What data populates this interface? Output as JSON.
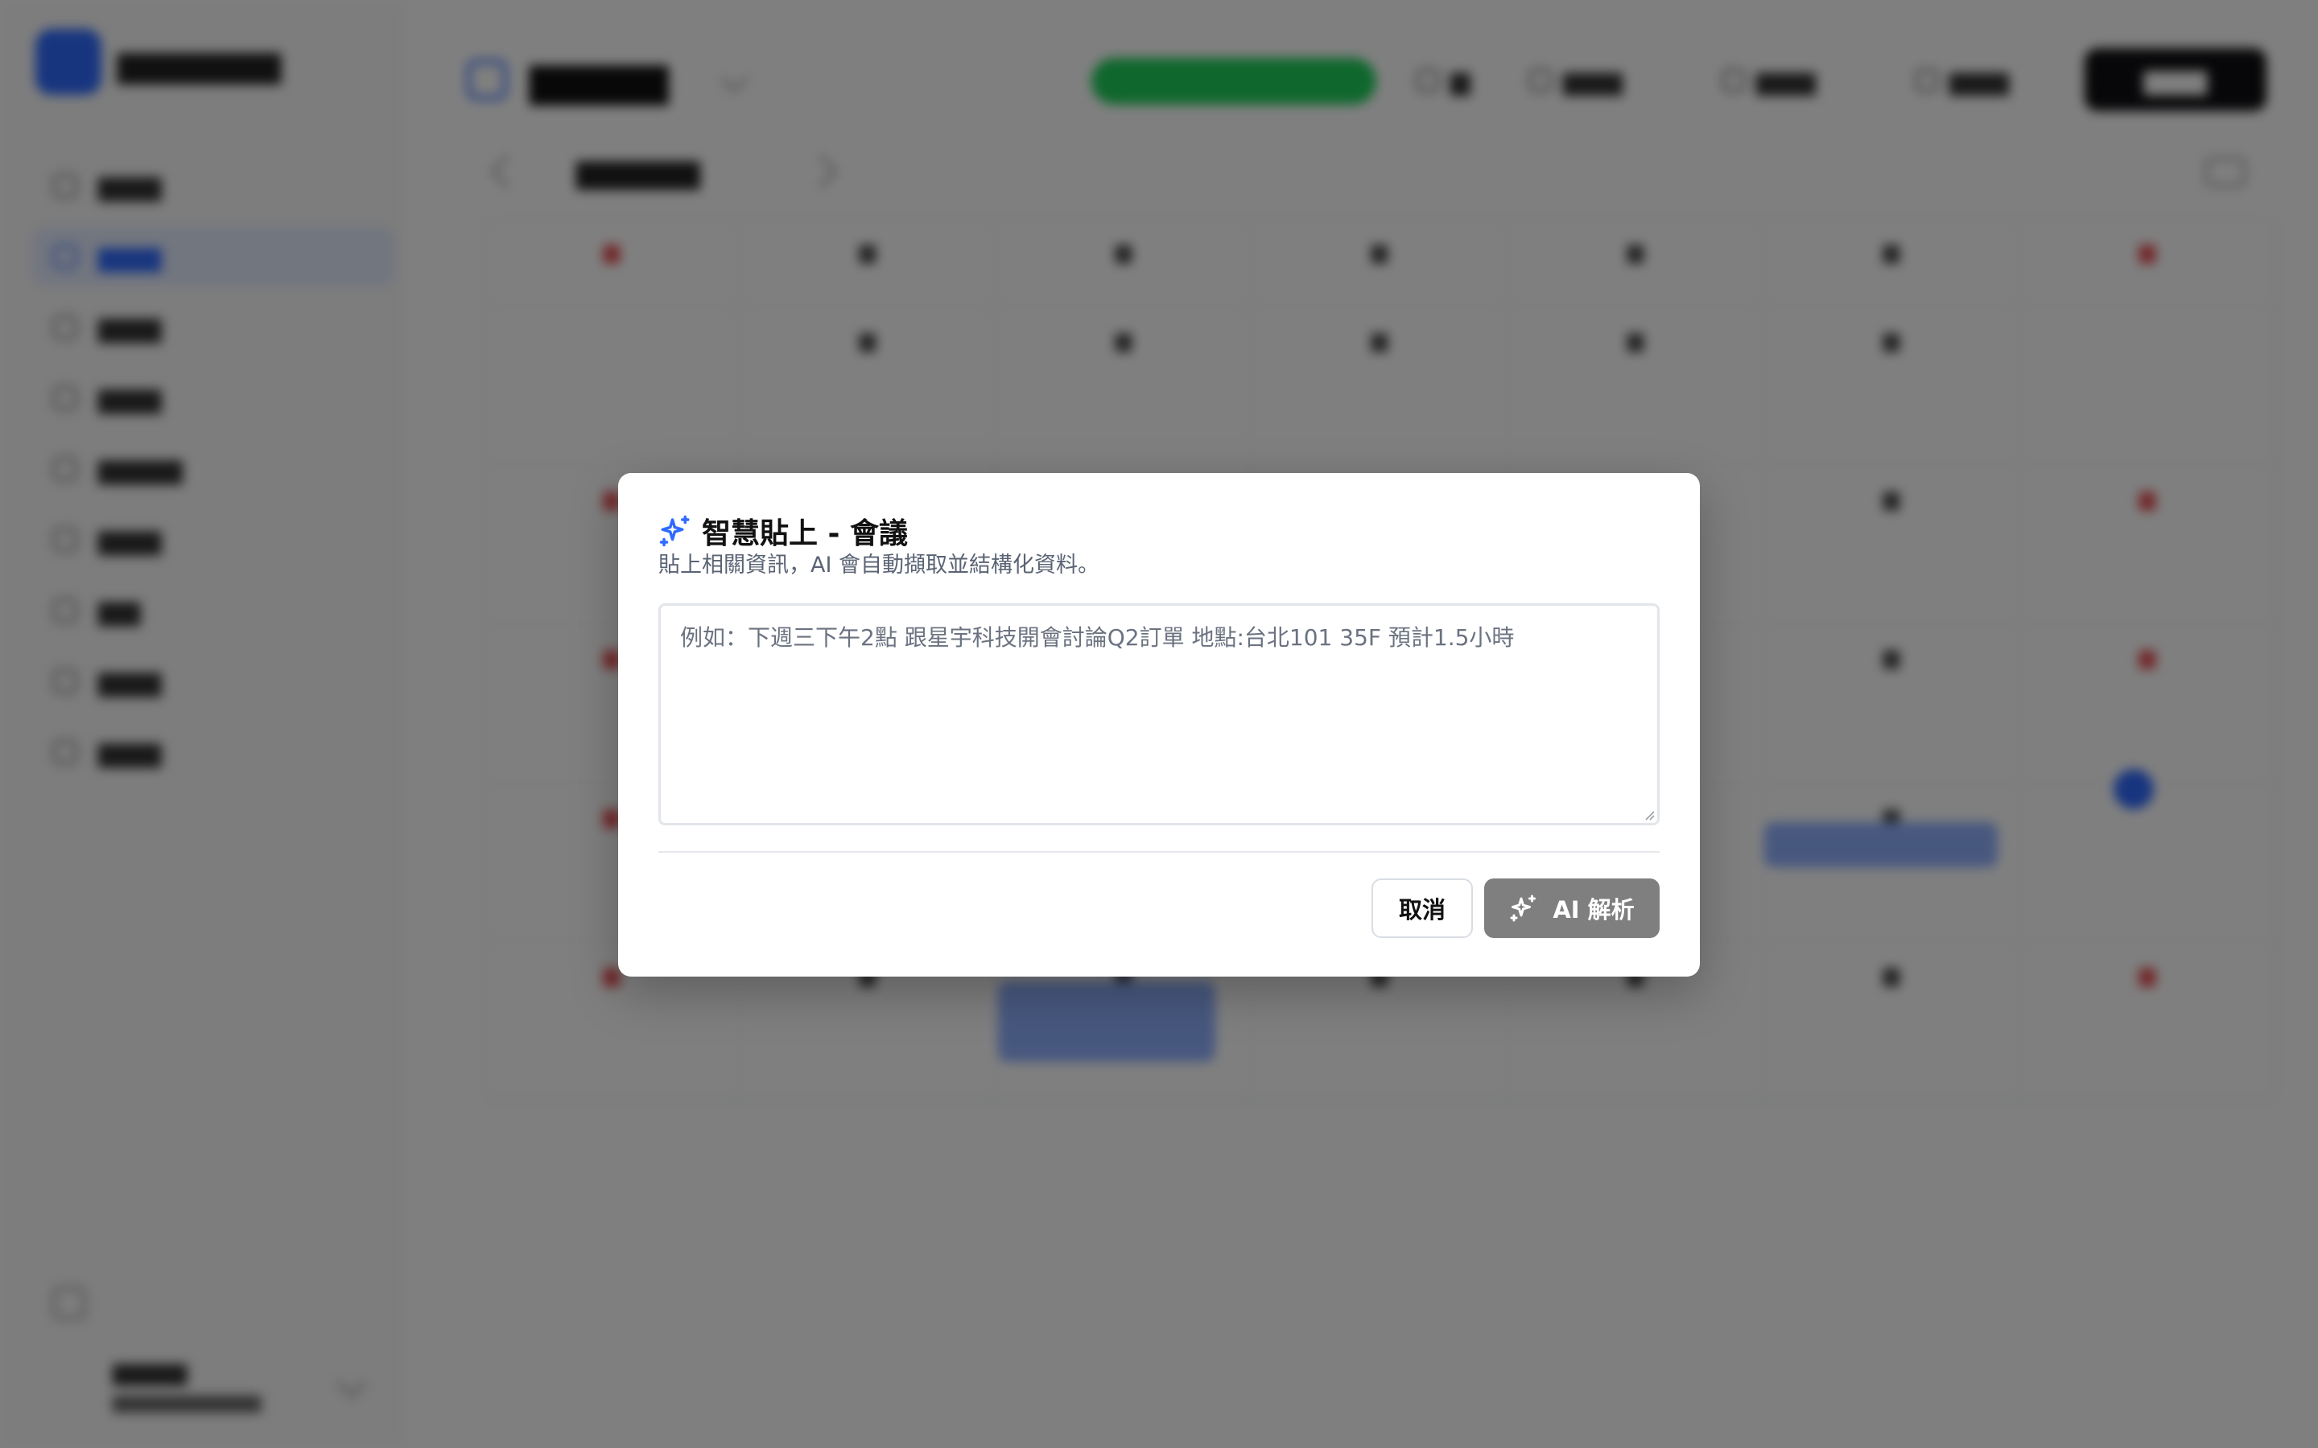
{
  "dialog": {
    "title": "智慧貼上 - 會議",
    "description": "貼上相關資訊，AI 會自動擷取並結構化資料。",
    "textarea": {
      "value": "",
      "placeholder": "例如：下週三下午2點 跟星宇科技開會討論Q2訂單 地點:台北101 35F 預計1.5小時"
    },
    "cancel_label": "取消",
    "submit_label": "AI 解析",
    "icons": {
      "title": "sparkles-icon",
      "submit": "sparkles-icon"
    },
    "accent_color": "#2f6bff",
    "submit_color": "#7f7f7f"
  },
  "overlay_color": "rgba(0,0,0,0.5)"
}
